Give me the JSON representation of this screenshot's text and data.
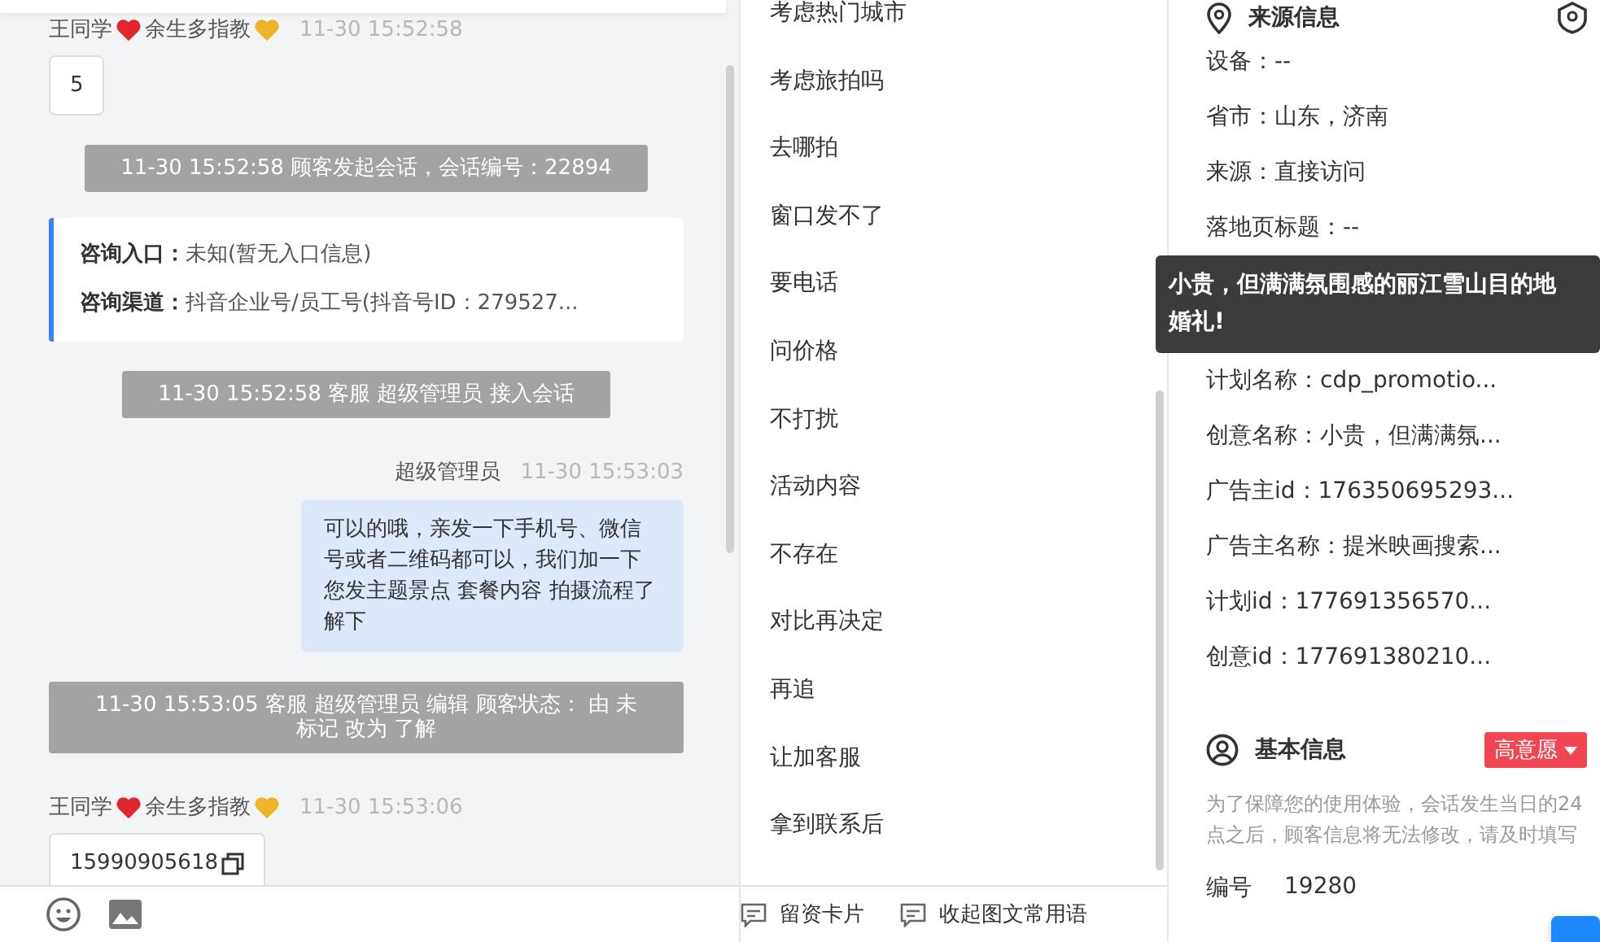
{
  "chat": {
    "messages": [
      {
        "kind": "incoming",
        "sender_parts": [
          {
            "text": "王同学",
            "color": "#e0262e"
          },
          {
            "text": "余生多指教",
            "color": "#f0b429"
          }
        ],
        "time": "11-30 15:52:58",
        "text": "5",
        "copyable": false
      },
      {
        "kind": "system",
        "text": "11-30 15:52:58 顾客发起会话，会话编号：22894"
      },
      {
        "kind": "info",
        "rows": [
          {
            "label": "咨询入口：",
            "value": "未知(暂无入口信息)"
          },
          {
            "label": "咨询渠道：",
            "value": "抖音企业号/员工号(抖音号ID：279527..."
          }
        ]
      },
      {
        "kind": "system",
        "text": "11-30 15:52:58 客服 超级管理员 接入会话"
      },
      {
        "kind": "outgoing",
        "sender": "超级管理员",
        "time": "11-30 15:53:03",
        "text": "可以的哦，亲发一下手机号、微信号或者二维码都可以，我们加一下您发主题景点 套餐内容 拍摄流程了解下"
      },
      {
        "kind": "system",
        "text": "11-30 15:53:05 客服 超级管理员 编辑 顾客状态： 由 未标记 改为 了解"
      },
      {
        "kind": "incoming",
        "sender_parts": [
          {
            "text": "王同学",
            "color": "#e0262e"
          },
          {
            "text": "余生多指教",
            "color": "#f0b429"
          }
        ],
        "time": "11-30 15:53:06",
        "text": "15990905618",
        "copyable": true
      }
    ]
  },
  "quick_replies": {
    "items": [
      "考虑热门城市",
      "考虑旅拍吗",
      "去哪拍",
      "窗口发不了",
      "要电话",
      "问价格",
      "不打扰",
      "活动内容",
      "不存在",
      "对比再决定",
      "再追",
      "让加客服",
      "拿到联系后"
    ],
    "buttons": [
      "留资卡片",
      "收起图文常用语"
    ]
  },
  "source_info": {
    "title": "来源信息",
    "rows": [
      {
        "kind": "row",
        "text": "设备：--"
      },
      {
        "kind": "row",
        "text": "省市：山东，济南"
      },
      {
        "kind": "row",
        "text": "来源：直接访问"
      },
      {
        "kind": "row",
        "text": "落地页标题：--"
      },
      {
        "kind": "tooltip",
        "text": "小贵，但满满氛围感的丽江雪山目的地婚礼!"
      },
      {
        "kind": "row",
        "text": "计划名称：cdp_promotio..."
      },
      {
        "kind": "row",
        "text": "创意名称：小贵，但满满氛..."
      },
      {
        "kind": "row",
        "text": "广告主id：176350695293..."
      },
      {
        "kind": "row",
        "text": "广告主名称：提米映画搜索..."
      },
      {
        "kind": "row",
        "text": "计划id：177691356570..."
      },
      {
        "kind": "row",
        "text": "创意id：177691380210..."
      }
    ]
  },
  "basic_info": {
    "title": "基本信息",
    "intent_tag": "高意愿",
    "note": "为了保障您的使用体验，会话发生当日的24点之后，顾客信息将无法修改，请及时填写",
    "fields": [
      {
        "label": "编号",
        "value": "19280"
      }
    ]
  }
}
